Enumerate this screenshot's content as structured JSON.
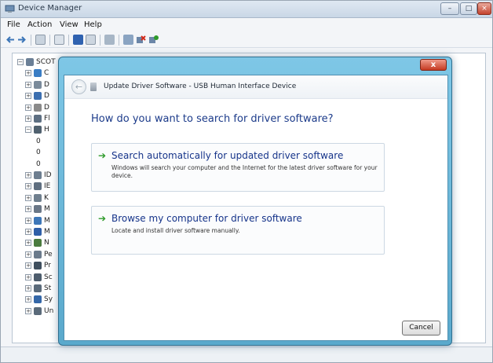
{
  "device_manager": {
    "title": "Device Manager",
    "menu": [
      "File",
      "Action",
      "View",
      "Help"
    ],
    "tree": [
      {
        "label": "SCOT",
        "expander": "−",
        "icon": "computer-icon",
        "color": "#6b7f96",
        "level": 0
      },
      {
        "label": "C",
        "expander": "+",
        "icon": "battery-icon",
        "color": "#3a7dc4",
        "level": 1
      },
      {
        "label": "D",
        "expander": "+",
        "icon": "disk-icon",
        "color": "#7a8a9a",
        "level": 1
      },
      {
        "label": "D",
        "expander": "+",
        "icon": "display-icon",
        "color": "#3c6fb0",
        "level": 1
      },
      {
        "label": "D",
        "expander": "+",
        "icon": "dvd-icon",
        "color": "#8a8a8a",
        "level": 1
      },
      {
        "label": "Fl",
        "expander": "+",
        "icon": "floppy-icon",
        "color": "#5d6f82",
        "level": 1
      },
      {
        "label": "H",
        "expander": "−",
        "icon": "hid-icon",
        "color": "#50616f",
        "level": 1
      },
      {
        "label": "0",
        "expander": "",
        "icon": "",
        "color": "#8e9aa6",
        "level": 2
      },
      {
        "label": "0",
        "expander": "",
        "icon": "",
        "color": "#8e9aa6",
        "level": 2
      },
      {
        "label": "0",
        "expander": "",
        "icon": "",
        "color": "#8e9aa6",
        "level": 2
      },
      {
        "label": "ID",
        "expander": "+",
        "icon": "ide-icon",
        "color": "#6c7d8f",
        "level": 1
      },
      {
        "label": "IE",
        "expander": "+",
        "icon": "ieee-icon",
        "color": "#5f6f80",
        "level": 1
      },
      {
        "label": "K",
        "expander": "+",
        "icon": "keyboard-icon",
        "color": "#6f7f8e",
        "level": 1
      },
      {
        "label": "M",
        "expander": "+",
        "icon": "mouse-icon",
        "color": "#6a7787",
        "level": 1
      },
      {
        "label": "M",
        "expander": "+",
        "icon": "monitor-icon",
        "color": "#3d77b8",
        "level": 1
      },
      {
        "label": "M",
        "expander": "+",
        "icon": "monitor-icon",
        "color": "#2f5fa8",
        "level": 1
      },
      {
        "label": "N",
        "expander": "+",
        "icon": "network-icon",
        "color": "#4a7b3e",
        "level": 1
      },
      {
        "label": "Pe",
        "expander": "+",
        "icon": "pcmcia-icon",
        "color": "#6b7b8c",
        "level": 1
      },
      {
        "label": "Pr",
        "expander": "+",
        "icon": "processor-icon",
        "color": "#3f4f5e",
        "level": 1
      },
      {
        "label": "Sc",
        "expander": "+",
        "icon": "sound-icon",
        "color": "#4d5d6d",
        "level": 1
      },
      {
        "label": "St",
        "expander": "+",
        "icon": "storage-icon",
        "color": "#5b6b7b",
        "level": 1
      },
      {
        "label": "Sy",
        "expander": "+",
        "icon": "system-icon",
        "color": "#3467a8",
        "level": 1
      },
      {
        "label": "Un",
        "expander": "+",
        "icon": "usb-icon",
        "color": "#5a6a7a",
        "level": 1
      }
    ]
  },
  "dialog": {
    "close_glyph": "x",
    "back_glyph": "←",
    "title": "Update Driver Software - USB Human Interface Device",
    "question": "How do you want to search for driver software?",
    "options": [
      {
        "arrow": "➔",
        "title": "Search automatically for updated driver software",
        "description": "Windows will search your computer and the Internet for the latest driver software for your device."
      },
      {
        "arrow": "➔",
        "title": "Browse my computer for driver software",
        "description": "Locate and install driver software manually."
      }
    ],
    "cancel_label": "Cancel"
  },
  "colors": {
    "dialog_frame": "#6fb8d8",
    "heading_text": "#1c3b8a",
    "option_title": "#16348a",
    "arrow_green": "#2e9a2a"
  }
}
